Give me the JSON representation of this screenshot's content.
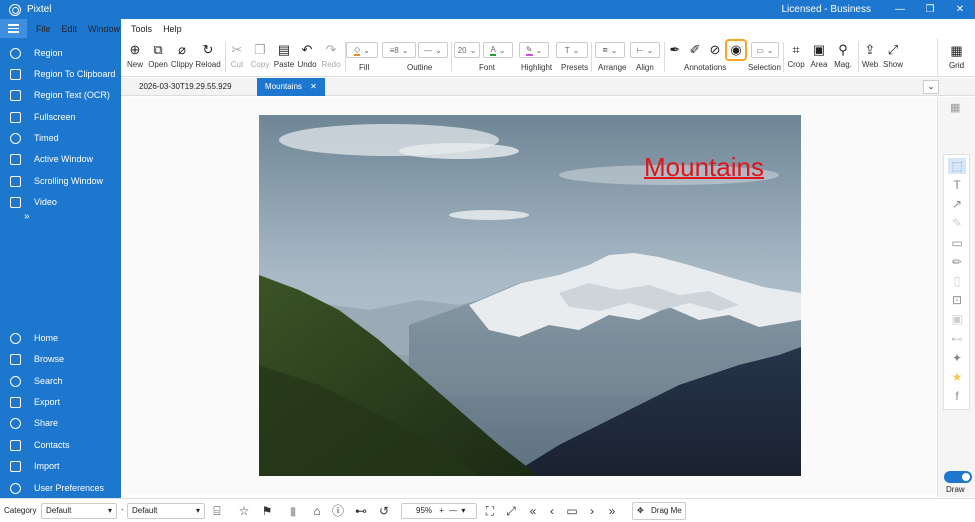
{
  "window": {
    "app_title": "Pixtel",
    "license": "Licensed - Business",
    "min": "—",
    "max": "❐",
    "close": "✕"
  },
  "menu": [
    "File",
    "Edit",
    "Window",
    "Tools",
    "Help"
  ],
  "sidebar": {
    "items": [
      {
        "label": "Region",
        "icon": "crosshair-icon"
      },
      {
        "label": "Region To Clipboard",
        "icon": "clipboard-icon"
      },
      {
        "label": "Region Text (OCR)",
        "icon": "document-text-icon"
      },
      {
        "label": "Fullscreen",
        "icon": "fullscreen-icon"
      },
      {
        "label": "Timed",
        "icon": "timer-icon"
      },
      {
        "label": "Active Window",
        "icon": "window-icon"
      },
      {
        "label": "Scrolling Window",
        "icon": "scroll-window-icon"
      },
      {
        "label": "Video",
        "icon": "video-camera-icon"
      }
    ],
    "more": "»",
    "bottom_items": [
      {
        "label": "Home",
        "icon": "gear-icon"
      },
      {
        "label": "Browse",
        "icon": "folder-icon"
      },
      {
        "label": "Search",
        "icon": "search-icon"
      },
      {
        "label": "Export",
        "icon": "export-icon"
      },
      {
        "label": "Share",
        "icon": "share-icon"
      },
      {
        "label": "Contacts",
        "icon": "contacts-icon"
      },
      {
        "label": "Import",
        "icon": "import-icon"
      },
      {
        "label": "User Preferences",
        "icon": "user-icon"
      }
    ]
  },
  "toolbar": {
    "new": "New",
    "open": "Open",
    "clippy": "Clippy",
    "reload": "Reload",
    "cut": "Cut",
    "copy": "Copy",
    "paste": "Paste",
    "undo": "Undo",
    "redo": "Redo",
    "fill": "Fill",
    "outline": "Outline",
    "font": "Font",
    "font_size": "20",
    "highlight": "Highlight",
    "presets": "Presets",
    "arrange": "Arrange",
    "align": "Align",
    "annotations": "Annotations",
    "selection": "Selection",
    "crop": "Crop",
    "area": "Area",
    "mag": "Mag.",
    "web": "Web",
    "show": "Show",
    "grid": "Grid"
  },
  "tabs": [
    {
      "label": "2026-03-30T19.29.55.929",
      "active": false
    },
    {
      "label": "Mountains",
      "active": true,
      "close": "✕"
    }
  ],
  "canvas": {
    "annotation_text": "Mountains",
    "annotation_color": "#e0141a"
  },
  "right_panel": {
    "draw_label": "Draw",
    "draw_on": true
  },
  "bottom": {
    "category_label": "Category",
    "category_value": "Default",
    "second_value": "Default",
    "zoom": "95%",
    "drag_me": "Drag Me"
  },
  "colors": {
    "accent": "#1e77cf",
    "active_outline": "#f5a623"
  }
}
